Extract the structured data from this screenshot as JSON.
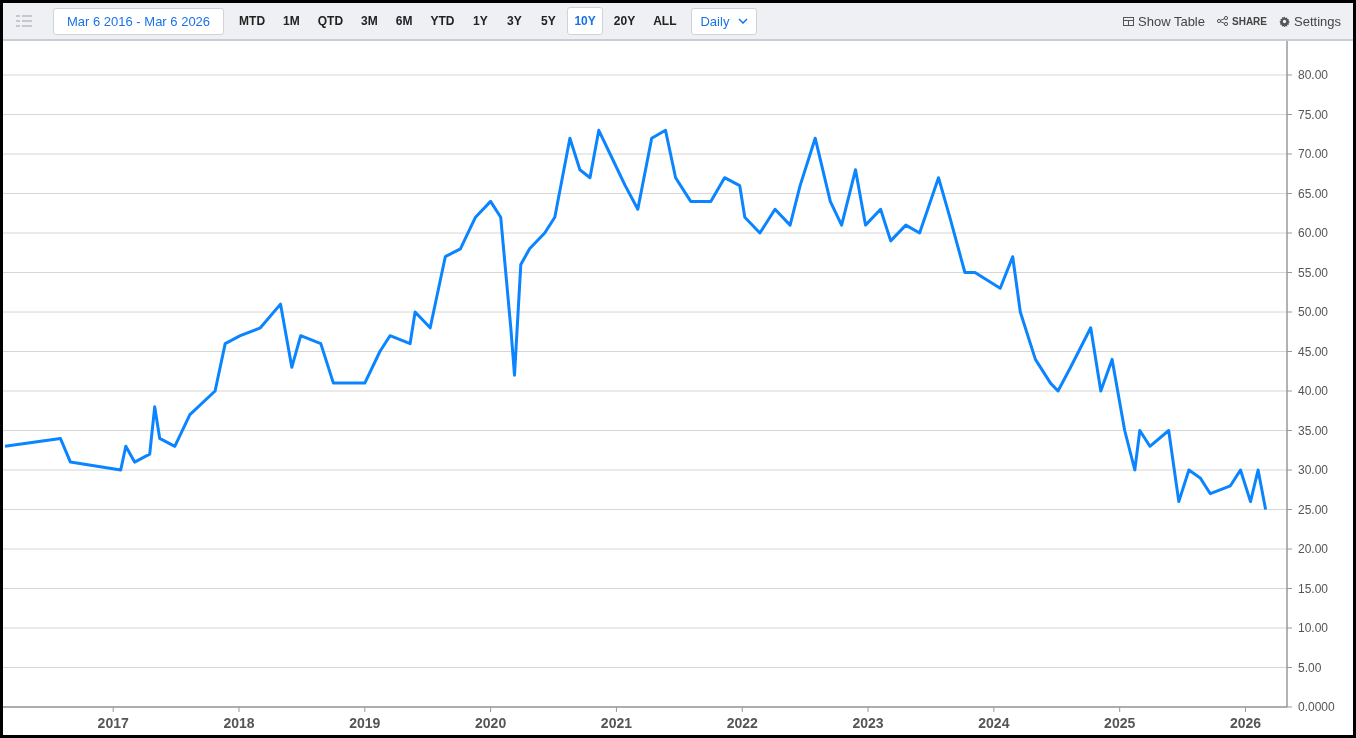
{
  "toolbar": {
    "date_range": "Mar 6 2016 - Mar 6 2026",
    "periods": [
      {
        "label": "MTD",
        "selected": false
      },
      {
        "label": "1M",
        "selected": false
      },
      {
        "label": "QTD",
        "selected": false
      },
      {
        "label": "3M",
        "selected": false
      },
      {
        "label": "6M",
        "selected": false
      },
      {
        "label": "YTD",
        "selected": false
      },
      {
        "label": "1Y",
        "selected": false
      },
      {
        "label": "3Y",
        "selected": false
      },
      {
        "label": "5Y",
        "selected": false
      },
      {
        "label": "10Y",
        "selected": true
      },
      {
        "label": "20Y",
        "selected": false
      },
      {
        "label": "ALL",
        "selected": false
      }
    ],
    "interval": "Daily",
    "actions": [
      {
        "kind": "table",
        "label": "Show Table"
      },
      {
        "kind": "share",
        "label": "SHARE"
      },
      {
        "kind": "settings",
        "label": "Settings"
      }
    ]
  },
  "chart": {
    "chart_data": {
      "type": "line",
      "grid": true,
      "xlim": [
        2016.14,
        2026.33
      ],
      "ylim": [
        0,
        80
      ],
      "xticks": [
        2017,
        2018,
        2019,
        2020,
        2021,
        2022,
        2023,
        2024,
        2025,
        2026
      ],
      "yticks": [
        {
          "value": 0,
          "label": "0.0000"
        },
        {
          "value": 5,
          "label": "5.00"
        },
        {
          "value": 10,
          "label": "10.00"
        },
        {
          "value": 15,
          "label": "15.00"
        },
        {
          "value": 20,
          "label": "20.00"
        },
        {
          "value": 25,
          "label": "25.00"
        },
        {
          "value": 30,
          "label": "30.00"
        },
        {
          "value": 35,
          "label": "35.00"
        },
        {
          "value": 40,
          "label": "40.00"
        },
        {
          "value": 45,
          "label": "45.00"
        },
        {
          "value": 50,
          "label": "50.00"
        },
        {
          "value": 55,
          "label": "55.00"
        },
        {
          "value": 60,
          "label": "60.00"
        },
        {
          "value": 65,
          "label": "65.00"
        },
        {
          "value": 70,
          "label": "70.00"
        },
        {
          "value": 75,
          "label": "75.00"
        },
        {
          "value": 80,
          "label": "80.00"
        }
      ],
      "x": [
        2016.14,
        2016.58,
        2016.66,
        2017.06,
        2017.1,
        2017.17,
        2017.29,
        2017.33,
        2017.37,
        2017.49,
        2017.61,
        2017.81,
        2017.89,
        2018.01,
        2018.17,
        2018.33,
        2018.42,
        2018.49,
        2018.65,
        2018.75,
        2019.0,
        2019.12,
        2019.2,
        2019.36,
        2019.4,
        2019.52,
        2019.64,
        2019.76,
        2019.88,
        2020.0,
        2020.08,
        2020.16,
        2020.19,
        2020.24,
        2020.31,
        2020.43,
        2020.51,
        2020.63,
        2020.71,
        2020.79,
        2020.86,
        2020.95,
        2021.07,
        2021.17,
        2021.28,
        2021.39,
        2021.47,
        2021.59,
        2021.75,
        2021.86,
        2021.98,
        2022.02,
        2022.14,
        2022.26,
        2022.38,
        2022.46,
        2022.58,
        2022.7,
        2022.79,
        2022.9,
        2022.98,
        2023.1,
        2023.18,
        2023.3,
        2023.41,
        2023.56,
        2023.65,
        2023.77,
        2023.85,
        2024.05,
        2024.15,
        2024.21,
        2024.33,
        2024.45,
        2024.51,
        2024.61,
        2024.77,
        2024.85,
        2024.94,
        2025.04,
        2025.12,
        2025.16,
        2025.24,
        2025.39,
        2025.47,
        2025.55,
        2025.64,
        2025.72,
        2025.88,
        2025.96,
        2026.04,
        2026.1,
        2026.16
      ],
      "series": [
        {
          "color": "#0a84ff",
          "values": [
            33,
            34,
            31,
            30,
            33,
            31,
            32,
            38,
            34,
            33,
            37,
            40,
            46,
            47,
            48,
            51,
            43,
            47,
            46,
            41,
            41,
            45,
            47,
            46,
            50,
            48,
            57,
            58,
            62,
            64,
            62,
            48,
            42,
            56,
            58,
            60,
            62,
            72,
            68,
            67,
            73,
            70,
            66,
            63,
            72,
            73,
            67,
            64,
            64,
            67,
            66,
            62,
            60,
            63,
            61,
            66,
            72,
            64,
            61,
            68,
            61,
            63,
            59,
            61,
            60,
            67,
            62,
            55,
            55,
            53,
            57,
            50,
            44,
            41,
            40,
            43,
            48,
            40,
            44,
            35,
            30,
            35,
            33,
            35,
            26,
            30,
            29,
            27,
            28,
            30,
            26,
            30,
            25
          ]
        }
      ]
    }
  }
}
